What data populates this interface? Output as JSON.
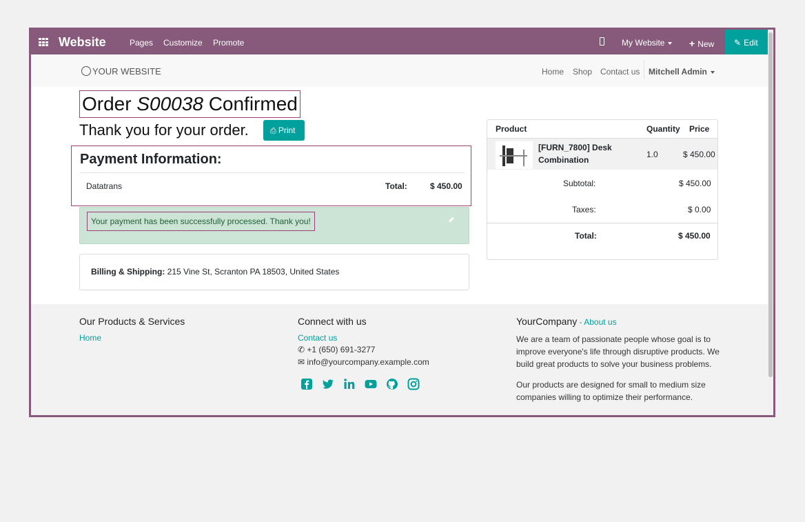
{
  "topbar": {
    "brand": "Website",
    "menu": [
      "Pages",
      "Customize",
      "Promote"
    ],
    "site_selector": "My Website",
    "new_label": "New",
    "edit_label": "Edit"
  },
  "site_header": {
    "logo": "YOUR WEBSITE",
    "nav": [
      "Home",
      "Shop",
      "Contact us"
    ],
    "user": "Mitchell Admin"
  },
  "order": {
    "title_prefix": "Order",
    "order_ref": "S00038",
    "title_suffix": "Confirmed",
    "thanks": "Thank you for your order.",
    "print_label": "Print"
  },
  "payment": {
    "heading": "Payment Information:",
    "method": "Datatrans",
    "total_label": "Total:",
    "total_value": "$ 450.00",
    "alert": "Your payment has been successfully processed. Thank you!"
  },
  "billing": {
    "label": "Billing & Shipping:",
    "address": "215 Vine St, Scranton PA 18503, United States"
  },
  "cart": {
    "headers": {
      "product": "Product",
      "quantity": "Quantity",
      "price": "Price"
    },
    "items": [
      {
        "name": "[FURN_7800] Desk Combination",
        "quantity": "1.0",
        "price": "$ 450.00"
      }
    ],
    "subtotal_label": "Subtotal:",
    "subtotal": "$ 450.00",
    "taxes_label": "Taxes:",
    "taxes": "$ 0.00",
    "total_label": "Total:",
    "total": "$ 450.00"
  },
  "footer": {
    "col1": {
      "heading": "Our Products & Services",
      "link": "Home"
    },
    "col2": {
      "heading": "Connect with us",
      "contact": "Contact us",
      "phone": "+1 (650) 691-3277",
      "email": "info@yourcompany.example.com",
      "social": [
        "facebook-icon",
        "twitter-icon",
        "linkedin-icon",
        "youtube-icon",
        "github-icon",
        "instagram-icon"
      ]
    },
    "col3": {
      "company": "YourCompany",
      "about": "About us",
      "p1": "We are a team of passionate people whose goal is to improve everyone's life through disruptive products. We build great products to solve your business problems.",
      "p2": "Our products are designed for small to medium size companies willing to optimize their performance."
    }
  },
  "colors": {
    "brand": "#875a7b",
    "accent": "#00a09d",
    "highlight": "#a03c78",
    "success_bg": "#cce4d5"
  }
}
